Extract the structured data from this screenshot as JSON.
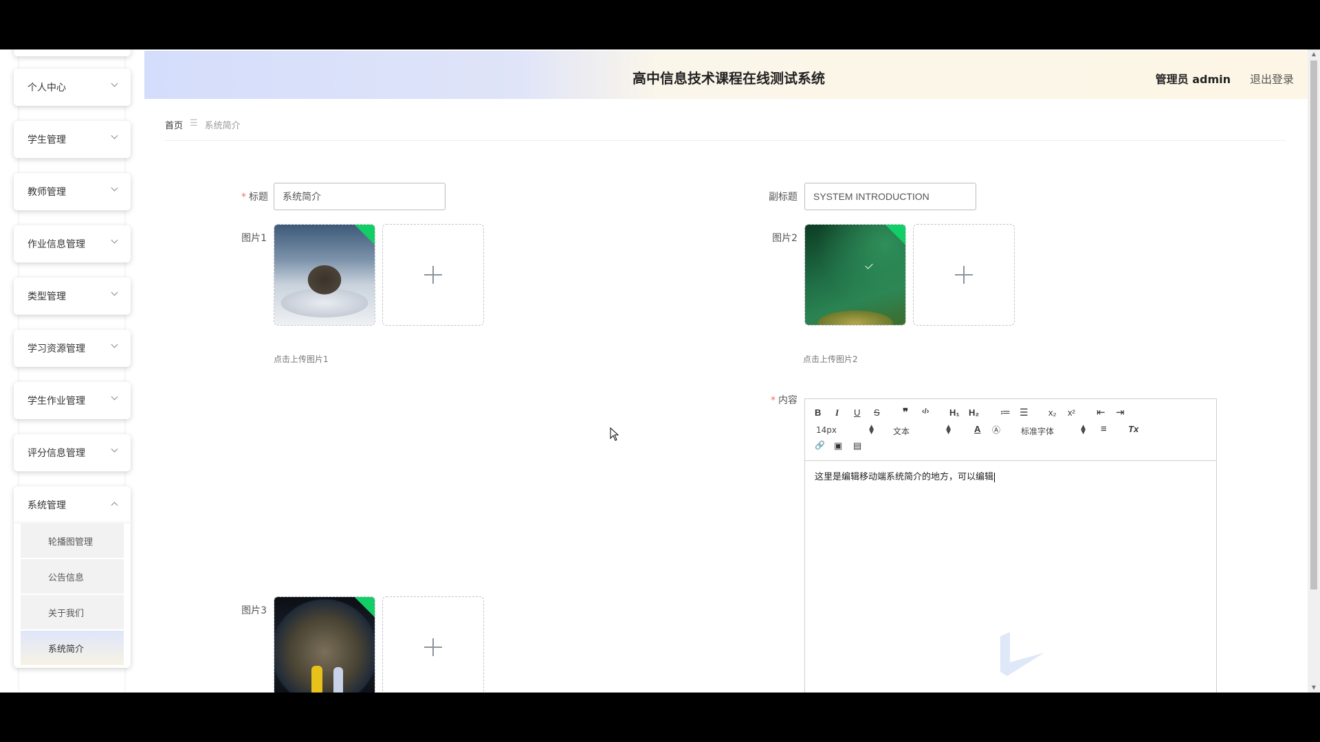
{
  "header": {
    "title": "高中信息技术课程在线测试系统",
    "user": "管理员 admin",
    "logout": "退出登录"
  },
  "sidebar": {
    "items": [
      {
        "label": "个人中心"
      },
      {
        "label": "学生管理"
      },
      {
        "label": "教师管理"
      },
      {
        "label": "作业信息管理"
      },
      {
        "label": "类型管理"
      },
      {
        "label": "学习资源管理"
      },
      {
        "label": "学生作业管理"
      },
      {
        "label": "评分信息管理"
      },
      {
        "label": "系统管理"
      }
    ],
    "sub_items": [
      {
        "label": "轮播图管理"
      },
      {
        "label": "公告信息"
      },
      {
        "label": "关于我们"
      },
      {
        "label": "系统简介"
      }
    ]
  },
  "breadcrumb": {
    "home": "首页",
    "separator": "☰",
    "current": "系统简介"
  },
  "form": {
    "title_label": "标题",
    "title_value": "系统简介",
    "subtitle_label": "副标题",
    "subtitle_value": "SYSTEM INTRODUCTION",
    "image1_label": "图片1",
    "image1_hint": "点击上传图片1",
    "image2_label": "图片2",
    "image2_hint": "点击上传图片2",
    "image3_label": "图片3",
    "content_label": "内容"
  },
  "editor": {
    "toolbar": {
      "bold": "B",
      "italic": "I",
      "underline": "U",
      "strike": "S",
      "quote": "❞",
      "code": "‹/›",
      "h1": "H₁",
      "h2": "H₂",
      "ordered": "≔",
      "bullet": "☰",
      "sub": "x₂",
      "sup": "x²",
      "outdent": "⇤",
      "indent": "⇥",
      "size": "14px",
      "header": "文本",
      "font": "标准字体",
      "color": "A",
      "background": "Ⓐ",
      "align": "≡",
      "clean": "Tx",
      "link": "🔗",
      "image": "▣",
      "video": "▤"
    },
    "content": "这里是编辑移动端系统简介的地方，可以编辑"
  },
  "colors": {
    "accent_green": "#13ce66",
    "required": "#f56c6c"
  }
}
